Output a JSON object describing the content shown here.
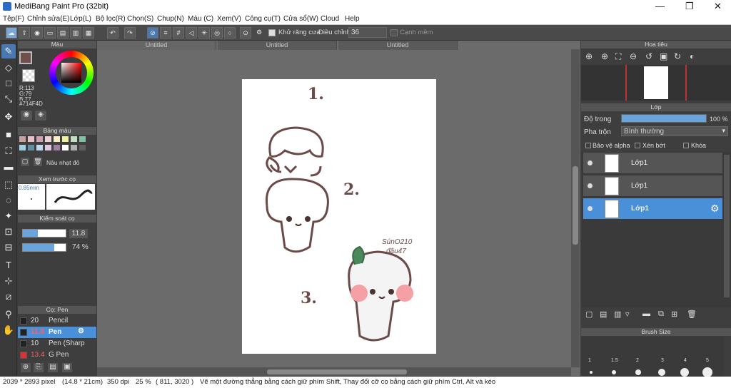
{
  "window": {
    "title": "MediBang Paint Pro (32bit)",
    "minimize": "—",
    "restore": "❐",
    "close": "✕"
  },
  "menu": [
    "Tệp(F)",
    "Chỉnh sửa(E)",
    "Lớp(L)",
    "Bộ lọc(R)",
    "Chọn(S)",
    "Chup(N)",
    "Màu (C)",
    "Xem(V)",
    "Công cụ(T)",
    "Cửa sổ(W)",
    "Cloud",
    "Help"
  ],
  "toolbar": {
    "antialias_label": "Khử răng cưa",
    "adjust_label": "Điều chỉnh",
    "adjust_value": "36",
    "edge_label": "Cạnh mềm"
  },
  "color_panel": {
    "title": "Màu",
    "r": "R:113",
    "g": "G:79",
    "b": "B:77",
    "hex": "#714F4D",
    "primary": "#714F4D"
  },
  "palette_panel": {
    "title": "Bảng màu",
    "swatch_name": "Nâu nhạt đỏ",
    "swatches": [
      "#c8a0a0",
      "#e8c0c8",
      "#d0a0b0",
      "#f0d0d8",
      "#f8f0c0",
      "#f0f0a0",
      "#c0e0c0",
      "#80c0a0",
      "#a0d0e0",
      "#6090a0",
      "#c0d8f0",
      "#e0c8e0",
      "#a080a0",
      "#ffffff",
      "#b0b0b0",
      "#606060"
    ]
  },
  "preview_panel": {
    "title": "Xem trước cọ",
    "size": "0.85mm"
  },
  "brush_control": {
    "title": "Kiểm soát cọ",
    "size_value": "11.8",
    "opacity_value": "74 %",
    "size_fraction": 0.35,
    "opacity_fraction": 0.74
  },
  "brush_panel": {
    "title": "Cọ: Pen",
    "items": [
      {
        "size": "20",
        "name": "Pencil",
        "color": "#222222"
      },
      {
        "size": "11.8",
        "name": "Pen",
        "color": "#222222"
      },
      {
        "size": "10",
        "name": "Pen (Sharp",
        "color": "#222222"
      },
      {
        "size": "13.4",
        "name": "G Pen",
        "color": "#e03030"
      }
    ]
  },
  "tabs": [
    "Untitled",
    "Untitled",
    "Untitled"
  ],
  "canvas": {
    "num1": "1.",
    "num2": "2.",
    "num3": "3.",
    "signature1": "SúnO210",
    "signature2": "đậu47"
  },
  "navigator": {
    "title": "Hoa tiêu"
  },
  "layer_panel": {
    "title": "Lớp",
    "opacity_label": "Độ trong",
    "opacity_value": "100 %",
    "opacity_fraction": 1.0,
    "blend_label": "Pha trộn",
    "blend_value": "Bình thường",
    "protect_alpha": "Bảo vệ alpha",
    "clip": "Xén bớt",
    "lock": "Khóa",
    "layers": [
      {
        "name": "Lớp1"
      },
      {
        "name": "Lớp1"
      },
      {
        "name": "Lớp1"
      }
    ]
  },
  "brush_size_panel": {
    "title": "Brush Size",
    "sizes": [
      "1",
      "1.5",
      "2",
      "3",
      "4",
      "5"
    ]
  },
  "status": {
    "dimensions": "2039 * 2893 pixel",
    "size_cm": "(14.8 * 21cm)",
    "dpi": "350 dpi",
    "zoom": "25 %",
    "coords": "( 811, 3020 )",
    "hint": "Vẽ một đường thẳng bằng cách giữ phím Shift, Thay đổi cỡ cọ bằng cách giữ phím Ctrl, Alt và kéo"
  }
}
